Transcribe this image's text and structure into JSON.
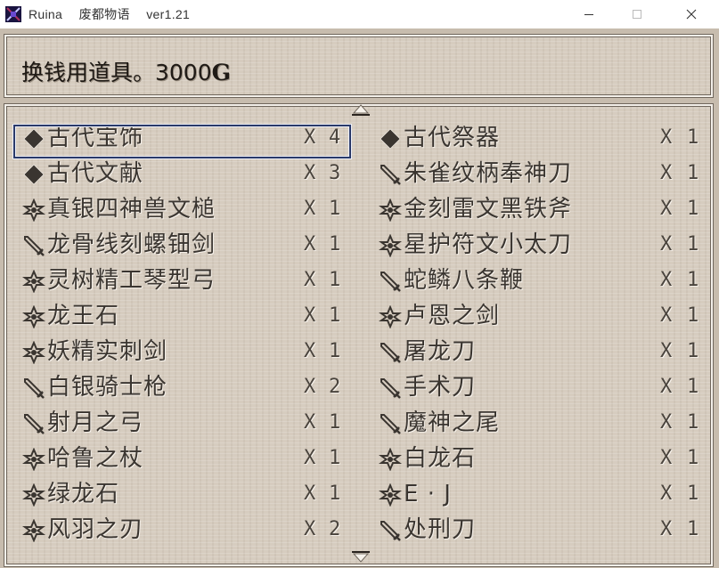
{
  "window": {
    "title": "Ruina　 废都物语　 ver1.21"
  },
  "help": {
    "text": "换钱用道具。3000",
    "gold_unit": "G"
  },
  "qty_prefix": "X",
  "items": [
    {
      "icon": "diamond-icon",
      "name": "古代宝饰",
      "qty": "4"
    },
    {
      "icon": "diamond-icon",
      "name": "古代祭器",
      "qty": "1"
    },
    {
      "icon": "diamond-icon",
      "name": "古代文献",
      "qty": "3"
    },
    {
      "icon": "sword-icon",
      "name": "朱雀纹柄奉神刀",
      "qty": "1"
    },
    {
      "icon": "star-icon",
      "name": "真银四神兽文槌",
      "qty": "1"
    },
    {
      "icon": "star-icon",
      "name": "金刻雷文黑铁斧",
      "qty": "1"
    },
    {
      "icon": "sword-icon",
      "name": "龙骨线刻螺钿剑",
      "qty": "1"
    },
    {
      "icon": "star-icon",
      "name": "星护符文小太刀",
      "qty": "1"
    },
    {
      "icon": "star-icon",
      "name": "灵树精工琴型弓",
      "qty": "1"
    },
    {
      "icon": "sword-icon",
      "name": "蛇鳞八条鞭",
      "qty": "1"
    },
    {
      "icon": "star-icon",
      "name": "龙王石",
      "qty": "1"
    },
    {
      "icon": "star-icon",
      "name": "卢恩之剑",
      "qty": "1"
    },
    {
      "icon": "star-icon",
      "name": "妖精实刺剑",
      "qty": "1"
    },
    {
      "icon": "sword-icon",
      "name": "屠龙刀",
      "qty": "1"
    },
    {
      "icon": "sword-icon",
      "name": "白银骑士枪",
      "qty": "2"
    },
    {
      "icon": "sword-icon",
      "name": "手术刀",
      "qty": "1"
    },
    {
      "icon": "sword-icon",
      "name": "射月之弓",
      "qty": "1"
    },
    {
      "icon": "sword-icon",
      "name": "魔神之尾",
      "qty": "1"
    },
    {
      "icon": "star-icon",
      "name": "哈鲁之杖",
      "qty": "1"
    },
    {
      "icon": "star-icon",
      "name": "白龙石",
      "qty": "1"
    },
    {
      "icon": "star-icon",
      "name": "绿龙石",
      "qty": "1"
    },
    {
      "icon": "star-icon",
      "name": "E · J",
      "qty": "1"
    },
    {
      "icon": "star-icon",
      "name": "风羽之刃",
      "qty": "2"
    },
    {
      "icon": "sword-icon",
      "name": "处刑刀",
      "qty": "1"
    }
  ],
  "selected_index": 0
}
